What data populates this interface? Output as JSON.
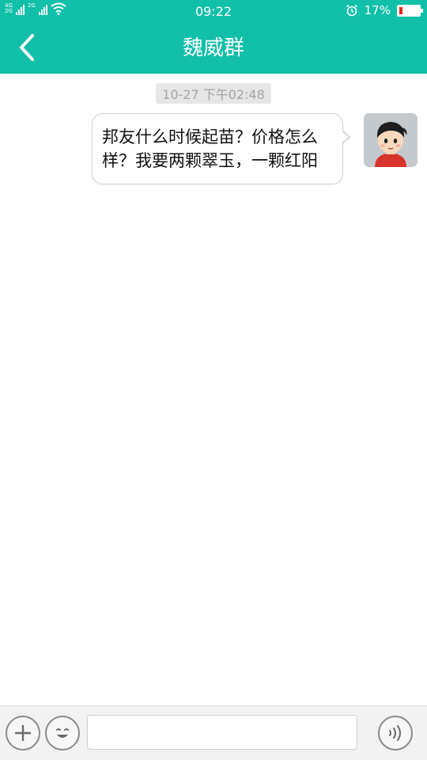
{
  "status_bar": {
    "network_top": "4G",
    "network_bottom": "2G",
    "network_2": "2G",
    "time": "09:22",
    "battery_percent": "17%",
    "battery_level": 0.17,
    "alarm_icon": "alarm-clock-icon"
  },
  "header": {
    "title": "魏威群",
    "back_icon": "chevron-left-icon"
  },
  "conversation": {
    "timestamp": "10-27 下午02:48",
    "messages": [
      {
        "sender": "self",
        "text": "邦友什么时候起苗？价格怎么样？我要两颗翠玉，一颗红阳"
      }
    ]
  },
  "input_bar": {
    "placeholder": "",
    "plus_icon": "plus-icon",
    "emoji_icon": "emoji-icon",
    "voice_icon": "voice-icon"
  },
  "colors": {
    "accent": "#12bfa8",
    "battery_low": "#e0271f",
    "bubble_border": "#d4d4d4",
    "timestamp_bg": "#e6e6e6"
  }
}
